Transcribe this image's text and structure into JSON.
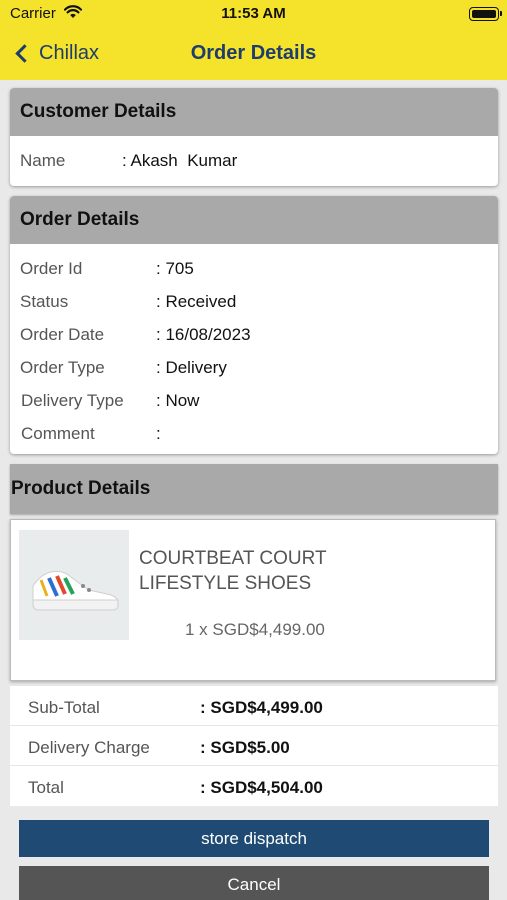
{
  "status_bar": {
    "carrier": "Carrier",
    "time": "11:53 AM"
  },
  "nav": {
    "back_label": "Chillax",
    "title": "Order Details"
  },
  "customer": {
    "header": "Customer Details",
    "name_label": "Name",
    "name_value": ": Akash  Kumar"
  },
  "order": {
    "header": "Order Details",
    "rows": [
      {
        "label": "Order Id",
        "value": ": 705"
      },
      {
        "label": "Status",
        "value": ": Received"
      },
      {
        "label": "Order Date",
        "value": ": 16/08/2023"
      },
      {
        "label": "Order Type",
        "value": ": Delivery"
      },
      {
        "label": "Delivery Type",
        "value": ": Now"
      },
      {
        "label": "Comment",
        "value": ":"
      }
    ]
  },
  "product": {
    "header": "Product Details",
    "name": "COURTBEAT COURT LIFESTYLE SHOES",
    "qty_price": "1 x SGD$4,499.00"
  },
  "totals": [
    {
      "label": "Sub-Total",
      "value": ": SGD$4,499.00"
    },
    {
      "label": "Delivery Charge",
      "value": ": SGD$5.00"
    },
    {
      "label": "Total",
      "value": ": SGD$4,504.00"
    }
  ],
  "buttons": {
    "dispatch": "store dispatch",
    "cancel": "Cancel"
  },
  "colors": {
    "nav_bg": "#f5e22a",
    "nav_text": "#1e3d6b",
    "header_bg": "#a9a9a9",
    "dispatch_bg": "#1e4a73",
    "cancel_bg": "#555555"
  }
}
